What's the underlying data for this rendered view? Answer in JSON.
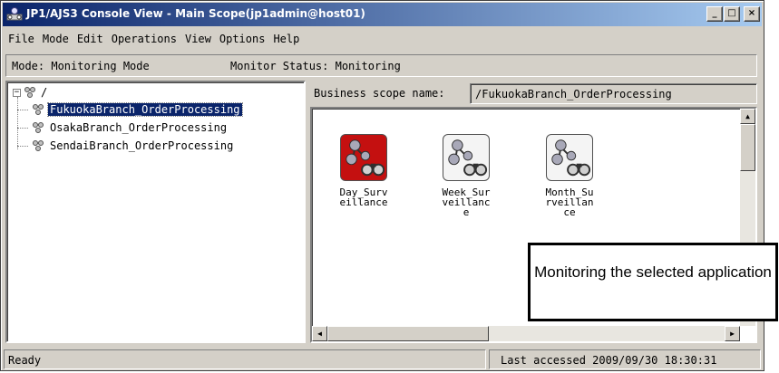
{
  "window": {
    "title": "JP1/AJS3 Console View - Main Scope(jp1admin@host01)",
    "controls": {
      "minimize": "_",
      "maximize": "□",
      "close": "×"
    }
  },
  "menu": {
    "items": [
      {
        "label": "File"
      },
      {
        "label": "Mode"
      },
      {
        "label": "Edit"
      },
      {
        "label": "Operations"
      },
      {
        "label": "View"
      },
      {
        "label": "Options"
      },
      {
        "label": "Help"
      }
    ]
  },
  "modebar": {
    "mode": "Mode: Monitoring Mode",
    "monitor_status": "Monitor Status: Monitoring"
  },
  "tree": {
    "root": "/",
    "items": [
      {
        "label": "FukuokaBranch_OrderProcessing",
        "selected": true
      },
      {
        "label": "OsakaBranch_OrderProcessing",
        "selected": false
      },
      {
        "label": "SendaiBranch_OrderProcessing",
        "selected": false
      }
    ]
  },
  "scope": {
    "label": "Business scope name:",
    "value": "/FukuokaBranch_OrderProcessing"
  },
  "jobnets": [
    {
      "label": "Day_Surveillance",
      "status": "alert",
      "color": "#c41010"
    },
    {
      "label": "Week_Surveillance",
      "status": "normal",
      "color": "#f4f4f4"
    },
    {
      "label": "Month_Surveillance",
      "status": "normal",
      "color": "#f4f4f4"
    }
  ],
  "status": {
    "left": "Ready",
    "right": "Last accessed 2009/09/30 18:30:31"
  },
  "callout": {
    "text": "Monitoring the selected application"
  }
}
